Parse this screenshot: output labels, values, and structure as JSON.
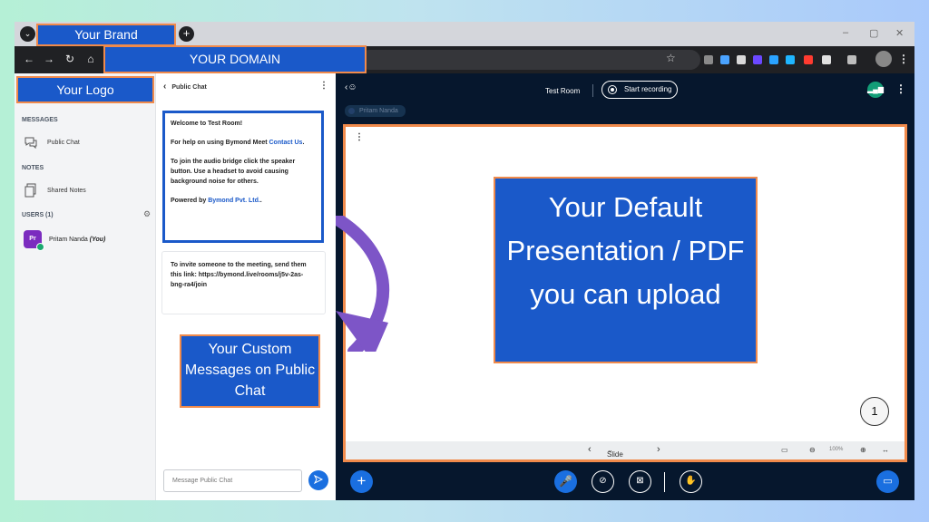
{
  "browser": {
    "tab_menu_icon": "chevron-down-icon",
    "brand_label": "Your Brand",
    "new_tab_icon": "plus-icon",
    "window_controls": [
      "–",
      "▢",
      "✕"
    ],
    "nav_icons": [
      "←",
      "→",
      "↻",
      "⌂"
    ],
    "domain_label": "YOUR DOMAIN",
    "extensions": [
      "#8a8a8a",
      "#4aa3ff",
      "#d9d9d9",
      "#6b48ff",
      "#2aa3ff",
      "#1fb6ff",
      "#ff3b30",
      "#e0e0e0",
      "#bdbdbd"
    ]
  },
  "sidebar": {
    "logo_label": "Your Logo",
    "messages_heading": "MESSAGES",
    "public_chat_label": "Public Chat",
    "notes_heading": "NOTES",
    "shared_notes_label": "Shared Notes",
    "users_heading": "USERS (1)",
    "user": {
      "initials": "Pr",
      "name": "Pritam Nanda",
      "you": "(You)"
    }
  },
  "chat": {
    "title": "Public Chat",
    "welcome": {
      "title_prefix": "Welcome to ",
      "room": "Test Room",
      "title_suffix": "!",
      "help_prefix": "For help on using Bymond Meet ",
      "help_link": "Contact Us",
      "help_suffix": ".",
      "audio_text": "To join the audio bridge click the speaker button. Use a headset to avoid causing background noise for others.",
      "powered_prefix": "Powered by ",
      "powered_link": "Bymond Pvt. Ltd.",
      "powered_suffix": "."
    },
    "invite_text": "To invite someone to the meeting, send them this link: https://bymond.live/rooms/j5v-2as-bng-ra4/join",
    "custom_messages_label": "Your Custom Messages on Public Chat",
    "input_placeholder": "Message Public Chat"
  },
  "main": {
    "room_name": "Test Room",
    "record_label": "Start recording",
    "talker": "Pritam Nanda",
    "presentation_label": "Your Default Presentation / PDF you can upload",
    "slide_number": "1",
    "slide_selector": "Slide 1",
    "zoom": "100%"
  },
  "colors": {
    "accent": "#1a59c9",
    "highlight": "#f08a4b",
    "arrow": "#7d55c7",
    "main_bg": "#06172d"
  }
}
